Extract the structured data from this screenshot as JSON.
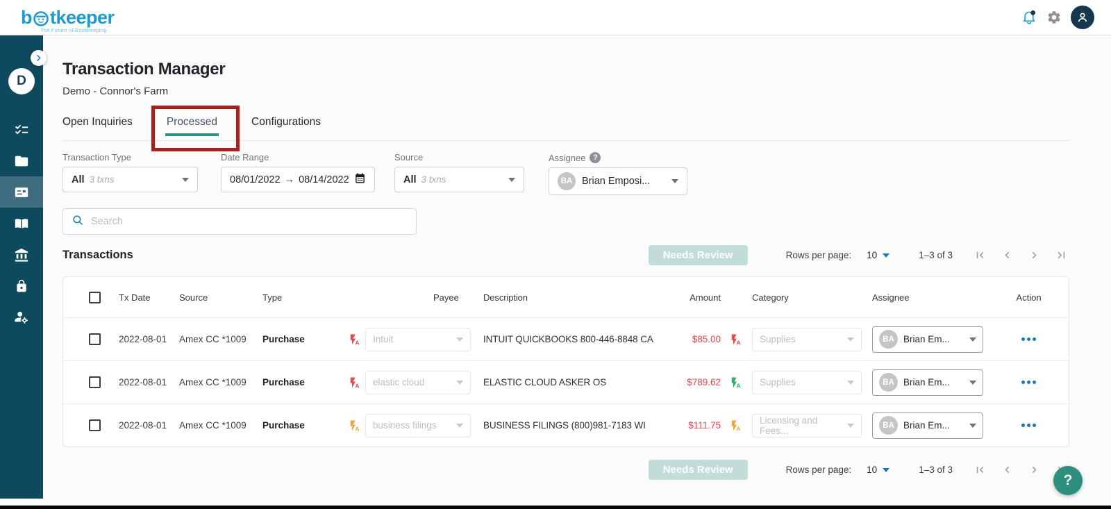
{
  "header": {
    "logo": {
      "part1": "b",
      "part2": "tkeeper",
      "tagline": "The Future of Bookkeeping"
    }
  },
  "sidebar": {
    "avatar_initial": "D",
    "items": [
      {
        "icon": "checklist-icon"
      },
      {
        "icon": "folder-icon"
      },
      {
        "icon": "card-icon",
        "active": true
      },
      {
        "icon": "book-icon"
      },
      {
        "icon": "bank-icon"
      },
      {
        "icon": "lock-icon"
      },
      {
        "icon": "user-gear-icon"
      }
    ]
  },
  "page": {
    "title": "Transaction Manager",
    "subtitle": "Demo - Connor's Farm"
  },
  "tabs": {
    "items": [
      {
        "label": "Open Inquiries",
        "active": false
      },
      {
        "label": "Processed",
        "active": true,
        "annotated": true
      },
      {
        "label": "Configurations",
        "active": false
      }
    ]
  },
  "filters": {
    "transaction_type": {
      "label": "Transaction Type",
      "value": "All",
      "hint": "3 txns"
    },
    "date_range": {
      "label": "Date Range",
      "start": "08/01/2022",
      "arrow": "→",
      "end": "08/14/2022"
    },
    "source": {
      "label": "Source",
      "value": "All",
      "hint": "3 txns"
    },
    "assignee": {
      "label": "Assignee",
      "avatar_initials": "BA",
      "value": "Brian Emposi..."
    }
  },
  "search": {
    "placeholder": "Search"
  },
  "transactions": {
    "heading": "Transactions",
    "needs_review_label": "Needs Review",
    "rows_per_page_label": "Rows per page:",
    "rows_per_page_value": "10",
    "range_label": "1–3 of 3",
    "columns": [
      "Tx Date",
      "Source",
      "Type",
      "Payee",
      "Description",
      "Amount",
      "Category",
      "Assignee",
      "Action"
    ],
    "rows": [
      {
        "tx_date": "2022-08-01",
        "source": "Amex CC *1009",
        "type": "Purchase",
        "payee": "Intuit",
        "payee_flash_color": "#e8494f",
        "description": "INTUIT QUICKBOOKS 800-446-8848 CA",
        "amount": "$85.00",
        "amount_flash_color": "#e8494f",
        "category": "Supplies",
        "assignee_initials": "BA",
        "assignee": "Brian Em..."
      },
      {
        "tx_date": "2022-08-01",
        "source": "Amex CC *1009",
        "type": "Purchase",
        "payee": "elastic cloud",
        "payee_flash_color": "#e8494f",
        "description": "ELASTIC CLOUD ASKER OS",
        "amount": "$789.62",
        "amount_flash_color": "#2eae6a",
        "category": "Supplies",
        "assignee_initials": "BA",
        "assignee": "Brian Em..."
      },
      {
        "tx_date": "2022-08-01",
        "source": "Amex CC *1009",
        "type": "Purchase",
        "payee": "business filings",
        "payee_flash_color": "#f0a63c",
        "description": "BUSINESS FILINGS (800)981-7183 WI",
        "amount": "$111.75",
        "amount_flash_color": "#f0a63c",
        "category": "Licensing and Fees...",
        "assignee_initials": "BA",
        "assignee": "Brian Em..."
      }
    ]
  },
  "help": {
    "label": "?"
  },
  "colors": {
    "brand_blue": "#1e9ad2",
    "sidebar_bg": "#0d4a5e",
    "accent_teal": "#2f8f83",
    "annotation_red": "#a32222",
    "amount_red": "#e8474d",
    "flash_red": "#e8494f",
    "flash_green": "#2eae6a",
    "flash_orange": "#f0a63c",
    "action_blue": "#1779ba",
    "needs_review_bg": "#c1dcd9",
    "help_fab_green": "#2e8f7e"
  }
}
